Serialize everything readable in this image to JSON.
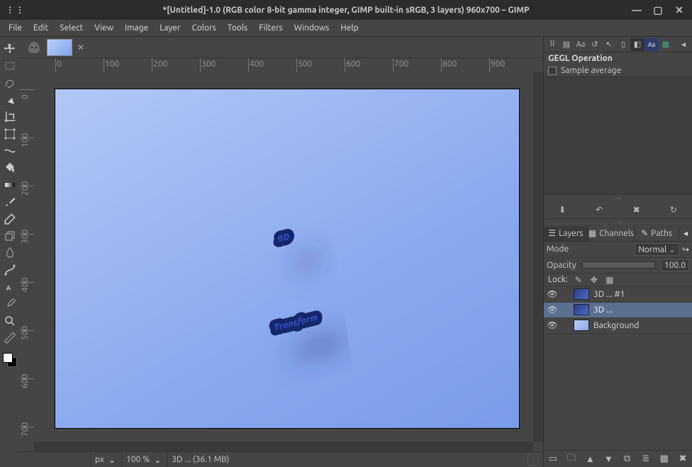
{
  "window": {
    "title": "*[Untitled]-1.0 (RGB color 8-bit gamma integer, GIMP built-in sRGB, 3 layers) 960x700 – GIMP"
  },
  "menu": [
    "File",
    "Edit",
    "Select",
    "View",
    "Image",
    "Layer",
    "Colors",
    "Tools",
    "Filters",
    "Windows",
    "Help"
  ],
  "rulers": {
    "horizontal": [
      "0",
      "100",
      "200",
      "300",
      "400",
      "500",
      "600",
      "700",
      "800",
      "900"
    ],
    "vertical": [
      "0",
      "100",
      "200",
      "300",
      "400",
      "500",
      "600",
      "700"
    ]
  },
  "canvas": {
    "text_top": "3D",
    "text_bottom": "Transform"
  },
  "gegl": {
    "title": "GEGL Operation",
    "sample_average": "Sample average"
  },
  "layers_panel": {
    "tabs": {
      "layers": "Layers",
      "channels": "Channels",
      "paths": "Paths"
    },
    "mode_label": "Mode",
    "mode_value": "Normal",
    "opacity_label": "Opacity",
    "opacity_value": "100.0",
    "lock_label": "Lock:",
    "layers": [
      {
        "name": "3D ... #1",
        "visible": true,
        "selected": false,
        "bg": false
      },
      {
        "name": "3D ...",
        "visible": true,
        "selected": true,
        "bg": false
      },
      {
        "name": "Background",
        "visible": true,
        "selected": false,
        "bg": true
      }
    ]
  },
  "status": {
    "unit": "px",
    "zoom": "100 %",
    "message": "3D ... (36.1 MB)"
  },
  "icons": {
    "search": "🔍",
    "save": "⬇",
    "undo": "↶",
    "redo": "↷",
    "delete": "✕",
    "visible": "👁",
    "new": "▱",
    "up": "▲",
    "down": "▼",
    "duplicate": "⧉",
    "anchor": "⚓",
    "mask": "▩",
    "merge": "≡",
    "chevron_down": "⌄",
    "link": "↪",
    "menu": "◂"
  }
}
